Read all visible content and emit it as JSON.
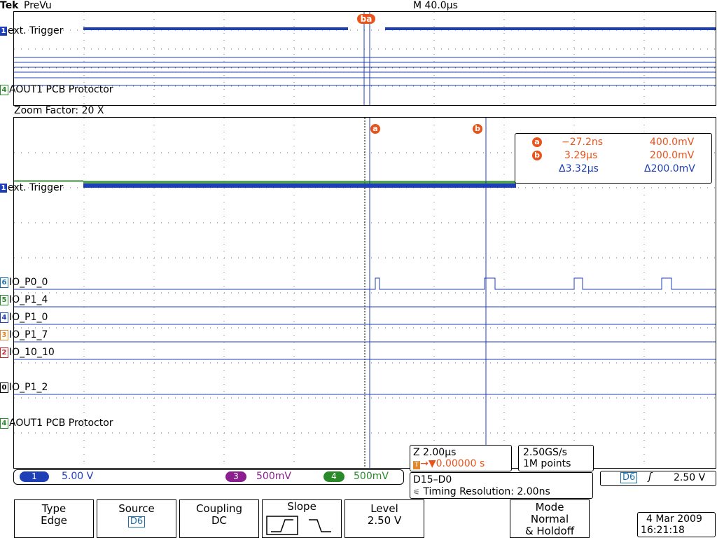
{
  "header": {
    "brand": "Tek",
    "mode": "PreVu",
    "timebase": "M 40.0µs"
  },
  "overview": {
    "cursor_label": "ba",
    "channels": [
      {
        "num": "1",
        "label": "ext. Trigger",
        "color": "#1f3fb7"
      },
      {
        "num": "4",
        "label": "AOUT1 PCB Protoctor",
        "color": "#2a8a2a"
      }
    ]
  },
  "zoom": {
    "factor_text": "Zoom Factor: 20 X"
  },
  "main": {
    "cursor_a_label": "a",
    "cursor_b_label": "b",
    "channels": [
      {
        "num": "1",
        "label": "ext. Trigger",
        "color": "#1f3fb7"
      },
      {
        "num": "6",
        "label": "IO_P0_0",
        "color": "#1e6fa8"
      },
      {
        "num": "5",
        "label": "IO_P1_4",
        "color": "#2a8a2a"
      },
      {
        "num": "4",
        "label": "IO_P1_0",
        "color": "#1f3fb7"
      },
      {
        "num": "3",
        "label": "IO_P1_7",
        "color": "#e0882b"
      },
      {
        "num": "2",
        "label": "IO_10_10",
        "color": "#c0282a"
      },
      {
        "num": "0",
        "label": "IO_P1_2",
        "color": "#000000"
      },
      {
        "num": "4",
        "label": "AOUT1 PCB Protoctor",
        "color": "#2a8a2a"
      }
    ]
  },
  "cursor_readout": {
    "a": {
      "time": "−27.2ns",
      "volt": "400.0mV"
    },
    "b": {
      "time": "3.29µs",
      "volt": "200.0mV"
    },
    "delta": {
      "time": "Δ3.32µs",
      "volt": "Δ200.0mV"
    }
  },
  "zoom_readout": {
    "scale": "Z 2.00µs",
    "position": "0.00000 s"
  },
  "acquisition": {
    "rate": "2.50GS/s",
    "points": "1M points"
  },
  "status_bar": {
    "ch1": {
      "num": "1",
      "scale": "5.00 V",
      "color": "#1f3fb7"
    },
    "ch3": {
      "num": "3",
      "scale": "500mV",
      "color": "#8b1f8f"
    },
    "ch4": {
      "num": "4",
      "scale": "500mV",
      "color": "#2a8a2a"
    }
  },
  "digital": {
    "range": "D15–D0",
    "timing": "Timing Resolution: 2.00ns"
  },
  "trigger": {
    "source": "D6",
    "level": "2.50 V"
  },
  "buttons": {
    "type": {
      "title": "Type",
      "value": "Edge"
    },
    "source": {
      "title": "Source",
      "value": "D6"
    },
    "coupling": {
      "title": "Coupling",
      "value": "DC"
    },
    "slope": {
      "title": "Slope"
    },
    "level": {
      "title": "Level",
      "value": "2.50 V"
    },
    "mode": {
      "title": "Mode",
      "line2": "Normal",
      "line3": "& Holdoff"
    }
  },
  "datetime": {
    "date": "4 Mar 2009",
    "time": "16:21:18"
  }
}
